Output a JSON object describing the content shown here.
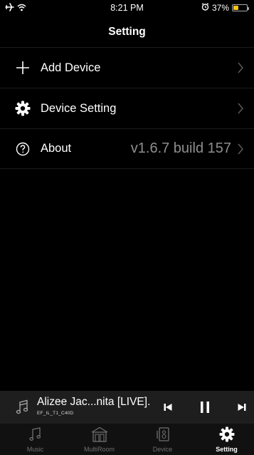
{
  "status_bar": {
    "time": "8:21 PM",
    "battery_text": "37%",
    "battery_level": 0.37,
    "battery_color": "#f5c518",
    "icons": [
      "airplane-icon",
      "wifi-icon",
      "alarm-icon",
      "battery-icon"
    ]
  },
  "nav": {
    "title": "Setting"
  },
  "menu": {
    "items": [
      {
        "label": "Add Device",
        "icon": "plus-icon",
        "value": ""
      },
      {
        "label": "Device Setting",
        "icon": "gear-icon",
        "value": ""
      },
      {
        "label": "About",
        "icon": "question-circle-icon",
        "value": "v1.6.7 build 157"
      }
    ]
  },
  "player": {
    "title": "Alizee Jac...nita [LIVE].",
    "subtitle": "EF_IL_T1_C40D",
    "icons": [
      "music-note-icon",
      "previous-icon",
      "pause-icon",
      "next-icon"
    ]
  },
  "tabs": {
    "items": [
      {
        "label": "Music",
        "icon": "music-note-icon",
        "active": false
      },
      {
        "label": "MultiRoom",
        "icon": "multiroom-icon",
        "active": false
      },
      {
        "label": "Device",
        "icon": "speaker-icon",
        "active": false
      },
      {
        "label": "Setting",
        "icon": "gear-icon",
        "active": true
      }
    ],
    "active_color": "#ffffff",
    "inactive_color": "#6f6f6f"
  }
}
